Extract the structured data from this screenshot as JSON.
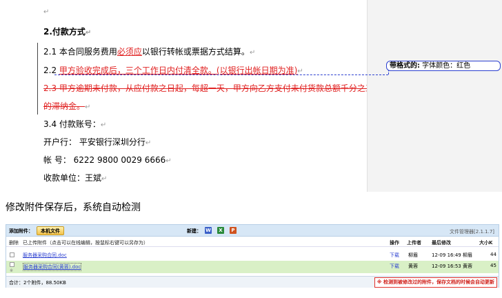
{
  "document": {
    "top_mark": "↵",
    "heading": "2.付款方式",
    "clause_2_1": {
      "prefix": "2.1 本合同服务费用",
      "inserted": "必须应",
      "suffix": "以银行转帐或票据方式结算。"
    },
    "clause_2_2": {
      "prefix": "2.2 ",
      "inserted": "甲方验收完成后，三个工作日内付清全款。(以银行出帐日期为准)"
    },
    "clause_2_3": {
      "deleted_line1": "2.3 甲方逾期未付款，从应付款之日起，每超一天，甲方向乙方支付未付货款总额千分之三",
      "deleted_line2": "的滞纳金。"
    },
    "clause_3_4": "3.4 付款账号：",
    "bank": "开户行：  平安银行深圳分行",
    "account": "帐    号：  6222 9800 0029 6666",
    "payee": "收款单位：王斌",
    "para_mark": "↵"
  },
  "balloon": {
    "label": "带格式的:",
    "text": " 字体颜色：红色"
  },
  "caption": "修改附件保存后，系统自动检测",
  "file_manager": {
    "add_label": "添加附件：",
    "local_file_button": "本机文件",
    "new_label": "新建：",
    "icons": [
      "word-icon",
      "excel-icon",
      "powerpoint-icon"
    ],
    "version": "文件管理器[2.1.1.7]",
    "header": {
      "delete": "删除",
      "uploaded": "已上传附件（点击可以在线编辑，按鼠标右键可以另存为）",
      "action": "操作",
      "uploader": "上传者",
      "last_modified": "最后修改",
      "size": "大小K"
    },
    "rows": [
      {
        "name": "服务器采购合同.doc",
        "action": "下载",
        "uploader": "柳眉",
        "modified": "12-09 16:49 柳眉",
        "size": "44"
      },
      {
        "name": "服务器采购合同(黄蓉).doc",
        "action": "下载",
        "uploader": "黄蓉",
        "modified": "12-09 16:53 黄蓉",
        "size": "45",
        "note": "※"
      }
    ],
    "footer": {
      "total": "合计：2个附件，88.50KB",
      "notice": "※ 检测到被修改过的附件，保存文档的时候会自动更新"
    }
  },
  "colors": {
    "revision_red": "#e02020",
    "format_line_blue": "#2b3fd0",
    "toolbar_bg": "#d7e7f6",
    "highlight_row": "#d9f0c6",
    "notice_red": "#d0201a"
  }
}
